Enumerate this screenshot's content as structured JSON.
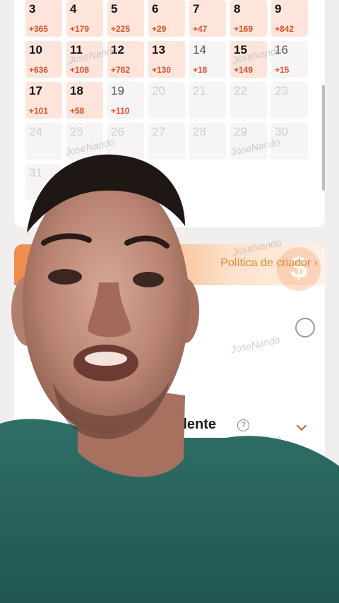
{
  "calendar": {
    "days": [
      {
        "day": "3",
        "delta": "+365",
        "state": "active"
      },
      {
        "day": "4",
        "delta": "+179",
        "state": "active"
      },
      {
        "day": "5",
        "delta": "+225",
        "state": "active"
      },
      {
        "day": "6",
        "delta": "+29",
        "state": "active"
      },
      {
        "day": "7",
        "delta": "+47",
        "state": "active"
      },
      {
        "day": "8",
        "delta": "+169",
        "state": "active"
      },
      {
        "day": "9",
        "delta": "+842",
        "state": "active"
      },
      {
        "day": "10",
        "delta": "+636",
        "state": "active"
      },
      {
        "day": "11",
        "delta": "+108",
        "state": "active"
      },
      {
        "day": "12",
        "delta": "+782",
        "state": "active"
      },
      {
        "day": "13",
        "delta": "+130",
        "state": "active"
      },
      {
        "day": "14",
        "delta": "+18",
        "state": "plain"
      },
      {
        "day": "15",
        "delta": "+149",
        "state": "active"
      },
      {
        "day": "16",
        "delta": "+15",
        "state": "plain"
      },
      {
        "day": "17",
        "delta": "+101",
        "state": "active"
      },
      {
        "day": "18",
        "delta": "+58",
        "state": "active"
      },
      {
        "day": "19",
        "delta": "+110",
        "state": "plain"
      },
      {
        "day": "20",
        "delta": "",
        "state": "future"
      },
      {
        "day": "21",
        "delta": "",
        "state": "future"
      },
      {
        "day": "22",
        "delta": "",
        "state": "future"
      },
      {
        "day": "23",
        "delta": "",
        "state": "future"
      },
      {
        "day": "24",
        "delta": "",
        "state": "future"
      },
      {
        "day": "25",
        "delta": "",
        "state": "future"
      },
      {
        "day": "26",
        "delta": "",
        "state": "future"
      },
      {
        "day": "27",
        "delta": "",
        "state": "future"
      },
      {
        "day": "28",
        "delta": "",
        "state": "future"
      },
      {
        "day": "29",
        "delta": "",
        "state": "future"
      },
      {
        "day": "30",
        "delta": "",
        "state": "future"
      },
      {
        "day": "31",
        "delta": "",
        "state": "future"
      }
    ]
  },
  "creator": {
    "policy_link": "Política de criador ›",
    "tier_label": "xcelente",
    "help_icon": "question-circle-icon",
    "dollar_icon": "dollar-coin-icon"
  },
  "watermark": "JoseNando",
  "colors": {
    "accent": "#e0532c",
    "active_cell": "#fde5dc",
    "link": "#e58a2a"
  }
}
